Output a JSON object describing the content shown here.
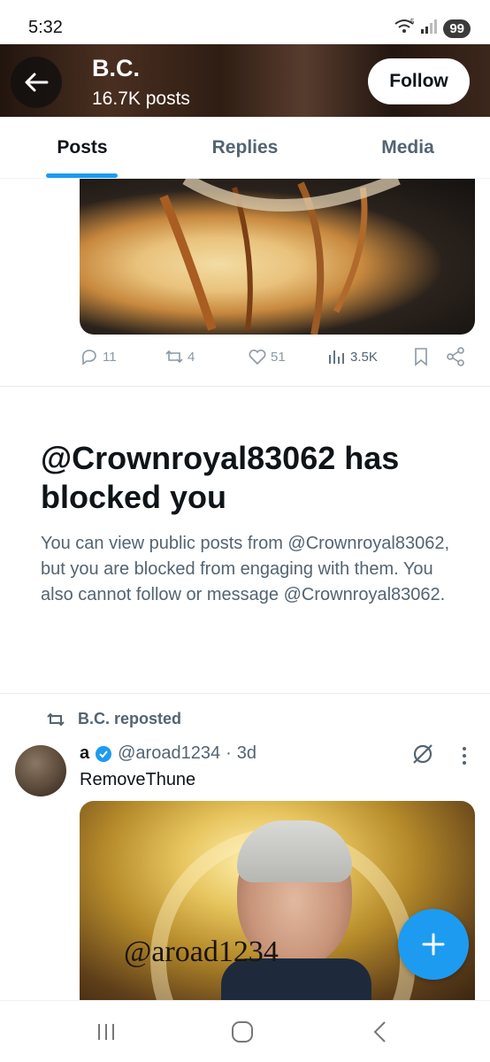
{
  "status": {
    "time": "5:32",
    "battery": "99",
    "wifi_icon": "wifi-icon",
    "signal_icon": "signal-icon",
    "wifi_badge": "5"
  },
  "header": {
    "title": "B.C.",
    "subtitle": "16.7K posts",
    "follow_label": "Follow"
  },
  "tabs": [
    {
      "label": "Posts",
      "active": true
    },
    {
      "label": "Replies"
    },
    {
      "label": "Media"
    }
  ],
  "post_actions": {
    "replies": "11",
    "reposts": "4",
    "likes": "51",
    "views": "3.5K"
  },
  "blocked": {
    "title": "@Crownroyal83062 has blocked you",
    "body": "You can view public posts from @Crownroyal83062, but you are blocked from engaging with them. You also cannot follow or message @Crownroyal83062."
  },
  "repost": {
    "label": "B.C. reposted"
  },
  "post": {
    "name": "a",
    "handle": "@aroad1234",
    "sep": "·",
    "time": "3d",
    "text": "RemoveThune",
    "watermark": "@aroad1234"
  },
  "colors": {
    "accent": "#1d9bf0",
    "text": "#0f1419",
    "muted": "#536471"
  }
}
